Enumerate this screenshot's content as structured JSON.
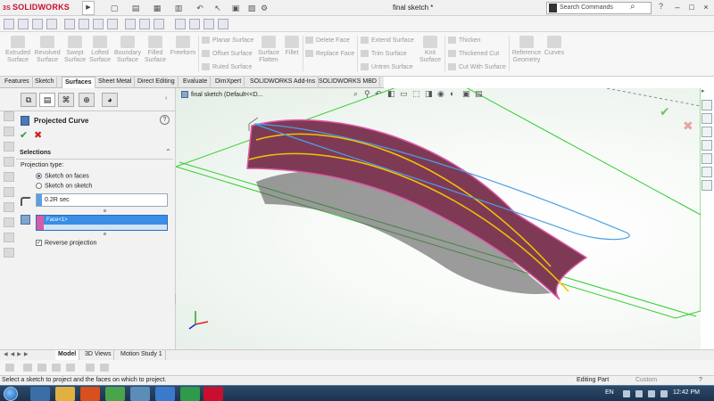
{
  "app": {
    "logo_prefix": "3S",
    "logo_text": "SOLIDWORKS",
    "document_title": "final sketch *",
    "search_placeholder": "Search Commands",
    "help_symbol": "?",
    "window_buttons": [
      "–",
      "□",
      "×"
    ]
  },
  "command_manager": {
    "surface_tools": [
      {
        "label": "Extruded\nSurface"
      },
      {
        "label": "Revolved\nSurface"
      },
      {
        "label": "Swept\nSurface"
      },
      {
        "label": "Lofted\nSurface"
      },
      {
        "label": "Boundary\nSurface"
      },
      {
        "label": "Filled\nSurface"
      },
      {
        "label": "Freeform"
      }
    ],
    "small_tools_col1": [
      "Planar Surface",
      "Offset Surface",
      "Ruled Surface"
    ],
    "surface_flatten": "Surface\nFlatten",
    "fillet": "Fillet",
    "small_tools_col2": [
      "Delete Face",
      "Replace Face"
    ],
    "small_tools_col3": [
      "Extend Surface",
      "Trim Surface",
      "Untrim Surface"
    ],
    "knit": "Knit\nSurface",
    "small_tools_col4": [
      "Thicken",
      "Thickened Cut",
      "Cut With Surface"
    ],
    "reference_geometry": "Reference\nGeometry",
    "curves": "Curves"
  },
  "tabs": [
    "Features",
    "Sketch",
    "Surfaces",
    "Sheet Metal",
    "Direct Editing",
    "Evaluate",
    "DimXpert",
    "SOLIDWORKS Add-Ins",
    "SOLIDWORKS MBD"
  ],
  "active_tab": "Surfaces",
  "property_manager": {
    "title": "Projected Curve",
    "help": "?",
    "ok": "✔",
    "cancel": "✖",
    "selections_title": "Selections",
    "projection_type_label": "Projection type:",
    "options": [
      "Sketch on faces",
      "Sketch on sketch"
    ],
    "selected_option": "Sketch on faces",
    "sketch_selection": "0.2R sec",
    "face_selection": "Face<1>",
    "reverse_projection_label": "Reverse projection",
    "reverse_projection_checked": true
  },
  "viewport": {
    "tree_label": "final sketch  (Default<<D..."
  },
  "bottom_tabs": [
    "Model",
    "3D Views",
    "Motion Study 1"
  ],
  "active_bottom_tab": "Model",
  "status": {
    "message": "Select a sketch to project and the faces on which to project.",
    "mode": "Editing Part",
    "units": "Custom",
    "help": "?"
  },
  "taskbar": {
    "language": "EN",
    "time": "12:42 PM"
  },
  "colors": {
    "surface_fill": "#7e3a55",
    "surface_edge": "#e05aa8",
    "projected_curve": "#f3c400",
    "sketch_spline": "#4a9fe8",
    "plane": "#2fcf2f",
    "accent_blue": "#3a8ee6"
  }
}
